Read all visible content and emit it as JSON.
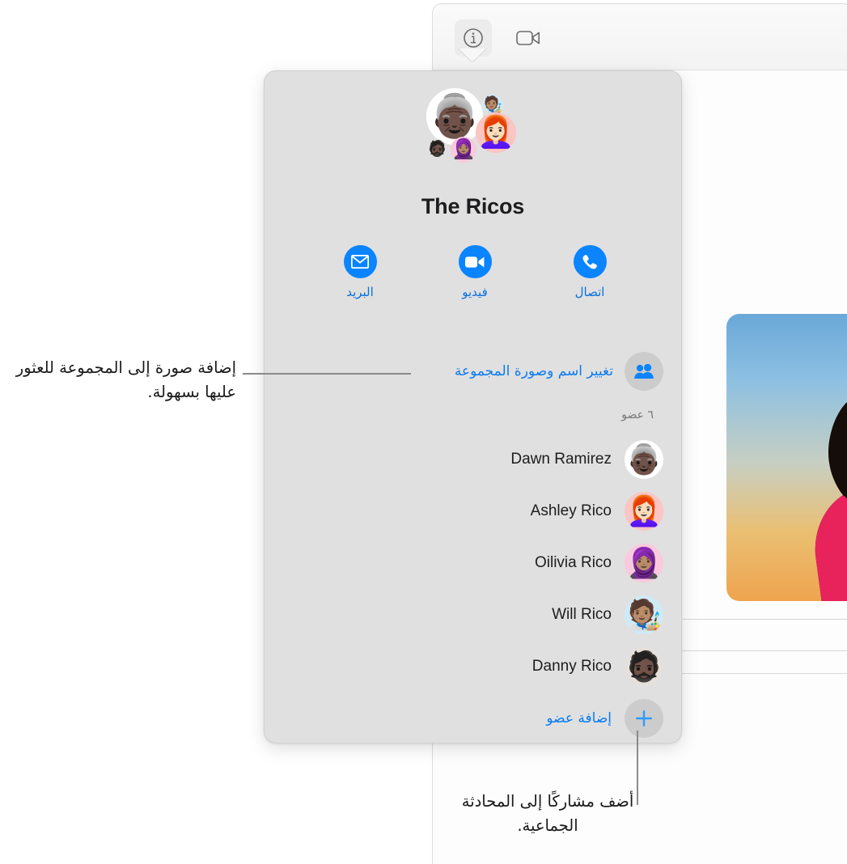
{
  "window": {
    "toolbar": {
      "info_button": "info-circle",
      "facetime_button": "video-camera"
    }
  },
  "popover": {
    "group_title": "The Ricos",
    "avatar_cluster": [
      {
        "name": "Dawn Ramirez",
        "emoji": "👵🏿",
        "bg": "#ffffff"
      },
      {
        "name": "Will Rico",
        "emoji": "🧑🏽‍🎨",
        "bg": "#cfeaf7"
      },
      {
        "name": "Ashley Rico",
        "emoji": "👩🏻‍🦰",
        "bg": "#fac5c3"
      },
      {
        "name": "Danny Rico",
        "emoji": "🧔🏿",
        "bg": "#e0e0e0"
      },
      {
        "name": "Oilivia Rico",
        "emoji": "🧕🏽",
        "bg": "#f9c9dd"
      }
    ],
    "actions": [
      {
        "label": "البريد",
        "icon": "mail-icon"
      },
      {
        "label": "فيديو",
        "icon": "video-icon"
      },
      {
        "label": "اتصال",
        "icon": "phone-icon"
      }
    ],
    "change_name_label": "تغيير اسم وصورة المجموعة",
    "member_count": "٦ عضو",
    "members": [
      {
        "name": "Dawn Ramirez",
        "emoji": "👵🏿",
        "bg": "#ffffff"
      },
      {
        "name": "Ashley Rico",
        "emoji": "👩🏻‍🦰",
        "bg": "#fac5c3"
      },
      {
        "name": "Oilivia Rico",
        "emoji": "🧕🏽",
        "bg": "#f9c9dd"
      },
      {
        "name": "Will Rico",
        "emoji": "🧑🏽‍🎨",
        "bg": "#cfeaf7"
      },
      {
        "name": "Danny Rico",
        "emoji": "🧔🏿",
        "bg": "#e5e0dc"
      }
    ],
    "add_member_label": "إضافة عضو"
  },
  "callouts": {
    "photo": "إضافة صورة إلى المجموعة للعثور عليها بسهولة.",
    "add": "أضف مشاركًا إلى المحادثة الجماعية."
  },
  "colors": {
    "accent": "#0a84ff",
    "link": "#0a7bf0",
    "panel_bg": "#e0e0e0",
    "muted_text": "#777777"
  }
}
